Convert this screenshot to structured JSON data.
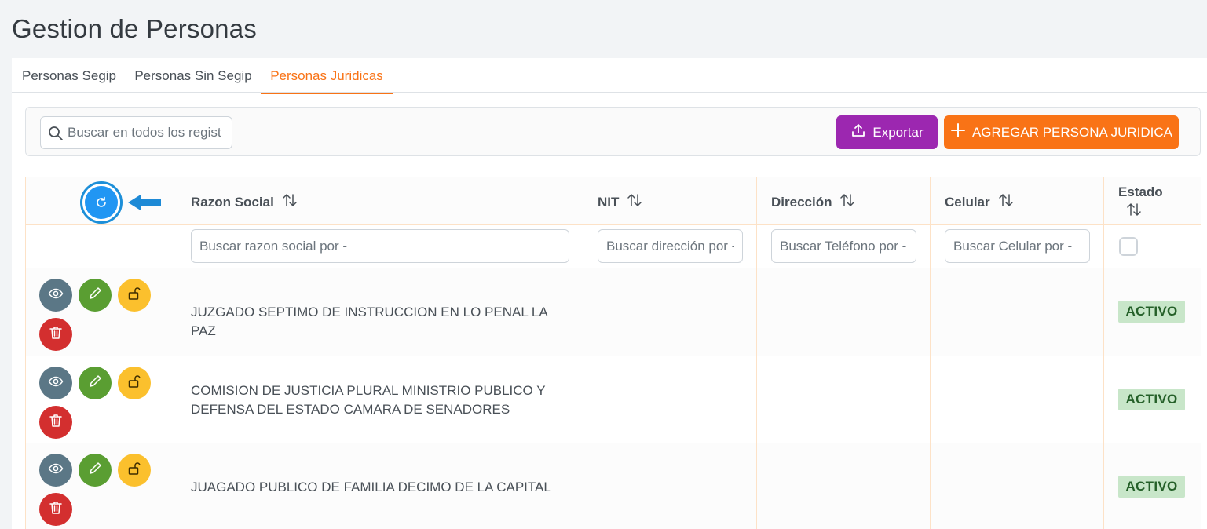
{
  "page": {
    "title": "Gestion de Personas"
  },
  "tabs": [
    {
      "label": "Personas Segip",
      "active": false
    },
    {
      "label": "Personas Sin Segip",
      "active": false
    },
    {
      "label": "Personas Juridicas",
      "active": true
    }
  ],
  "toolbar": {
    "search_placeholder": "Buscar en todos los regist",
    "export_label": "Exportar",
    "add_label": "AGREGAR PERSONA JURIDICA"
  },
  "table": {
    "columns": [
      {
        "label": "Razon Social"
      },
      {
        "label": "NIT"
      },
      {
        "label": "Dirección"
      },
      {
        "label": "Celular"
      },
      {
        "label": "Estado"
      }
    ],
    "filters": {
      "razon_social": "Buscar razon social por -",
      "nit": "Buscar dirección por -",
      "direccion": "Buscar Teléfono por -",
      "celular": "Buscar Celular por -"
    },
    "rows": [
      {
        "razon_social": "JUZGADO SEPTIMO DE INSTRUCCION EN LO PENAL LA PAZ",
        "nit": "",
        "direccion": "",
        "celular": "",
        "estado": "ACTIVO"
      },
      {
        "razon_social": "COMISION DE JUSTICIA PLURAL MINISTRIO PUBLICO Y DEFENSA DEL ESTADO CAMARA DE SENADORES",
        "nit": "",
        "direccion": "",
        "celular": "",
        "estado": "ACTIVO"
      },
      {
        "razon_social": "JUAGADO PUBLICO DE FAMILIA DECIMO DE LA CAPITAL",
        "nit": "",
        "direccion": "",
        "celular": "",
        "estado": "ACTIVO"
      }
    ]
  },
  "colors": {
    "accent": "#f97316",
    "export": "#9c27b0",
    "refresh": "#2196f3",
    "view": "#5b7786",
    "edit": "#5a9e32",
    "lock": "#fbc02d",
    "delete": "#d32f2f",
    "badge_bg": "#c8e6c9",
    "badge_text": "#256029"
  },
  "icons": {
    "search": "search-icon",
    "export": "upload-icon",
    "add": "plus-icon",
    "refresh": "refresh-icon",
    "pointer": "arrow-left-icon",
    "sort": "sort-icon",
    "view": "eye-icon",
    "edit": "pencil-icon",
    "lock": "unlock-icon",
    "delete": "trash-icon"
  }
}
